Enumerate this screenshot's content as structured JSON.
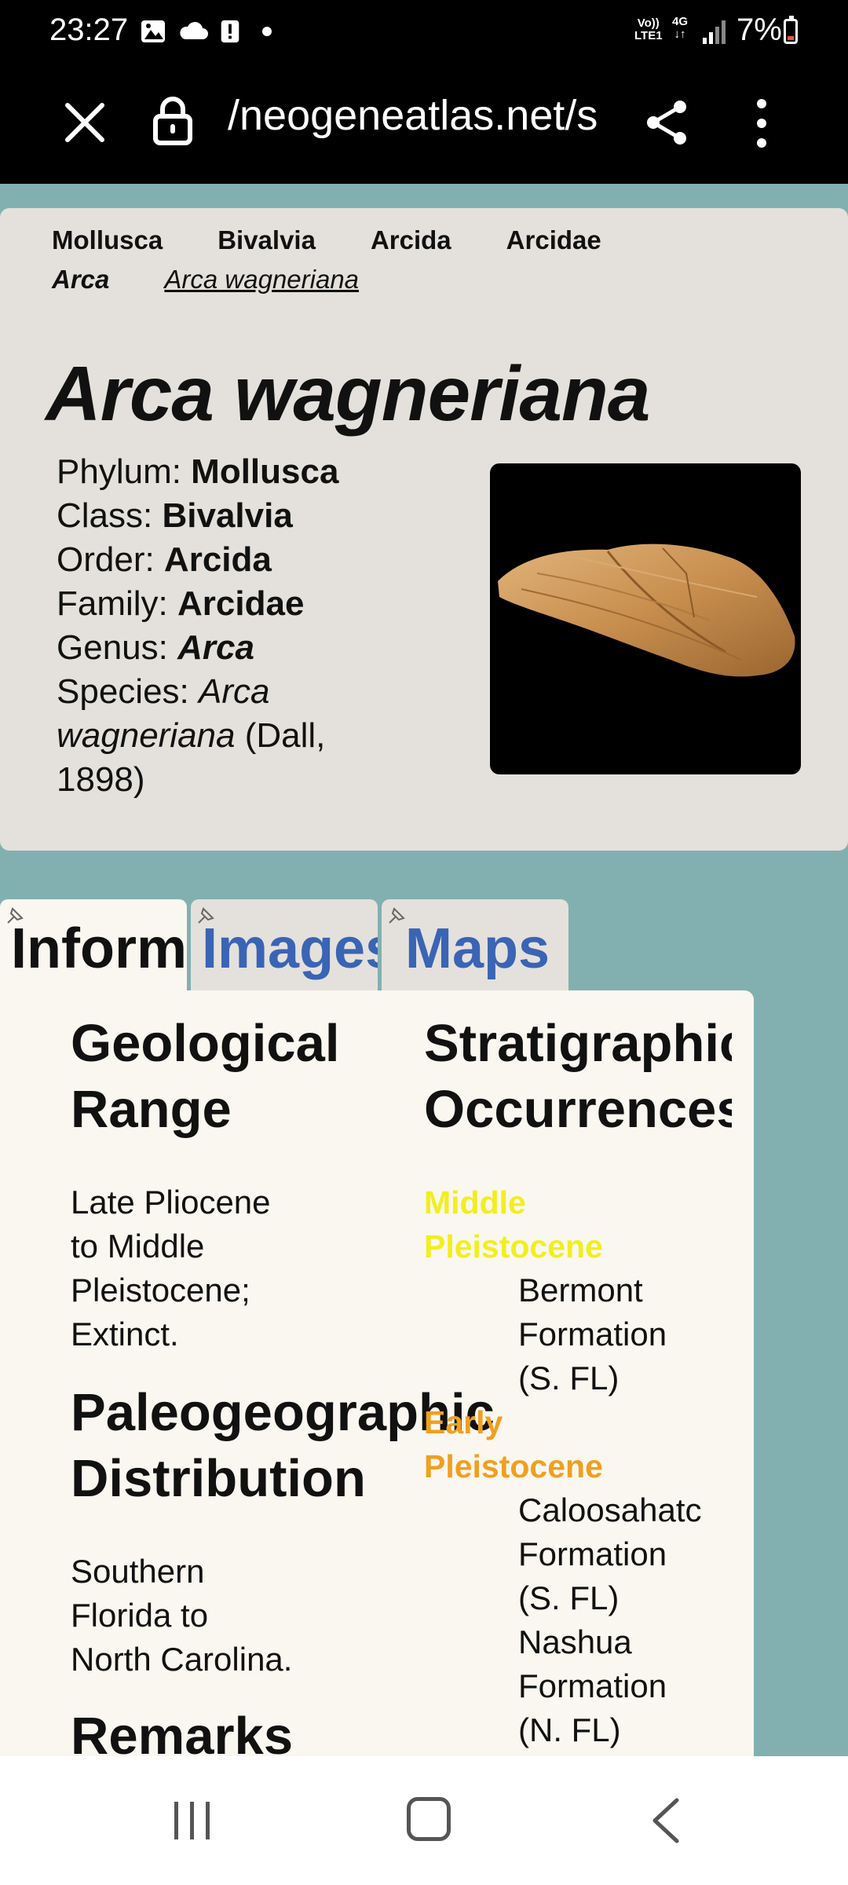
{
  "status_bar": {
    "time": "23:27",
    "network_label_top": "Vo))",
    "network_label_bottom": "LTE1",
    "data_label": "4G",
    "battery_percent": "7%",
    "icons": [
      "image-icon",
      "cloud-icon",
      "alert-icon",
      "dot-icon",
      "signal-icon",
      "battery-icon"
    ]
  },
  "browser": {
    "url": "/neogeneatlas.net/s",
    "close_icon": "close-icon",
    "lock_icon": "lock-icon",
    "share_icon": "share-icon",
    "menu_icon": "more-vert-icon"
  },
  "breadcrumb": {
    "items": [
      "Mollusca",
      "Bivalvia",
      "Arcida",
      "Arcidae",
      "Arca",
      "Arca wagneriana"
    ]
  },
  "species": {
    "title": "Arca wagneriana",
    "phylum_label": "Phylum: ",
    "phylum": "Mollusca",
    "class_label": "Class: ",
    "class": "Bivalvia",
    "order_label": "Order: ",
    "order": "Arcida",
    "family_label": "Family: ",
    "family": "Arcidae",
    "genus_label": "Genus: ",
    "genus": "Arca",
    "species_label": "Species: ",
    "species_line1": "Arca",
    "species_line2": "wagneriana",
    "authority_part1": " (Dall,",
    "authority_part2": "1898)"
  },
  "tabs": [
    {
      "label": "Informa",
      "active": true
    },
    {
      "label": "Images",
      "active": false
    },
    {
      "label": "Maps",
      "active": false
    }
  ],
  "content": {
    "geological_range": {
      "heading_line1": "Geological",
      "heading_line2": "Range",
      "text_lines": [
        "Late Pliocene",
        "to Middle",
        "Pleistocene;",
        "Extinct."
      ]
    },
    "paleogeographic": {
      "heading_line1": "Paleogeographic",
      "heading_line2": "Distribution",
      "text_lines": [
        "Southern",
        "Florida to",
        "North Carolina."
      ]
    },
    "remarks": {
      "heading": "Remarks"
    },
    "stratigraphic": {
      "heading_line1": "Stratigraphic",
      "heading_line2": "Occurrences",
      "groups": [
        {
          "epoch_line1": "Middle",
          "epoch_line2": "Pleistocene",
          "color": "#f2ee1e",
          "formations": [
            [
              "Bermont",
              "Formation",
              "(S. FL)"
            ]
          ]
        },
        {
          "epoch_line1": "Early",
          "epoch_line2": "Pleistocene",
          "color": "#f0a020",
          "formations": [
            [
              "Caloosahatc",
              "Formation",
              "(S. FL)"
            ],
            [
              "Nashua",
              "Formation",
              "(N. FL)"
            ]
          ]
        }
      ]
    }
  },
  "nav_bar": {
    "icons": [
      "recent-apps-icon",
      "home-icon",
      "back-icon"
    ]
  }
}
